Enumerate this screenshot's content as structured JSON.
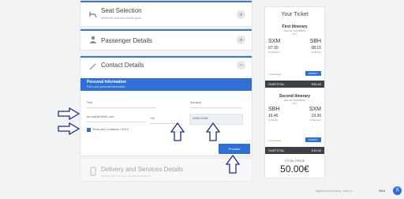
{
  "booking": {
    "seat": {
      "title": "Seat Selection",
      "subtitle": "Select the seat and vehicle types"
    },
    "passenger": {
      "title": "Passenger Details"
    },
    "contact": {
      "title": "Contact Details",
      "banner_title": "Personal Information",
      "banner_sub": "Fill in your personal information",
      "field_first": "First",
      "field_last": "Surname",
      "field_email": "pc.rubin@GMAIL.com",
      "field_country_code": "+90",
      "field_phone": "5558123456",
      "terms_label": "Terms and Conditions / KVKK",
      "proceed": "Proceed"
    },
    "delivery": {
      "title": "Delivery and Services Details",
      "subtitle": "Delivery services and additional services"
    }
  },
  "ticket": {
    "header": "Your Ticket",
    "first": {
      "label": "First Itinerary",
      "ship": "SEA JET EXPRESS",
      "date": "02.9",
      "from": "SXM",
      "to": "SBH",
      "dep": "07:30",
      "arr": "08:15",
      "dep_place": "St Maarten",
      "arr_place": "St Barths",
      "pax": "1 passenger",
      "modify": "MODIFY",
      "subtotal_label": "SUBTOTAL",
      "subtotal": "€35.00"
    },
    "second": {
      "label": "Second Itinerary",
      "ship": "SEA JET EXPRESS",
      "date": "02.9",
      "from": "SBH",
      "to": "SXM",
      "dep": "16:45",
      "arr": "19:30",
      "dep_place": "St Barths",
      "arr_place": "St Maarten",
      "pax": "1 passenger",
      "modify": "MODIFY",
      "subtotal_label": "SUBTOTAL",
      "subtotal": "€15.00"
    },
    "total_label": "TOTAL PRICE",
    "total": "50.00€"
  },
  "footer": {
    "credit": "Digital ticket booking, made in",
    "brand": "SEA"
  }
}
